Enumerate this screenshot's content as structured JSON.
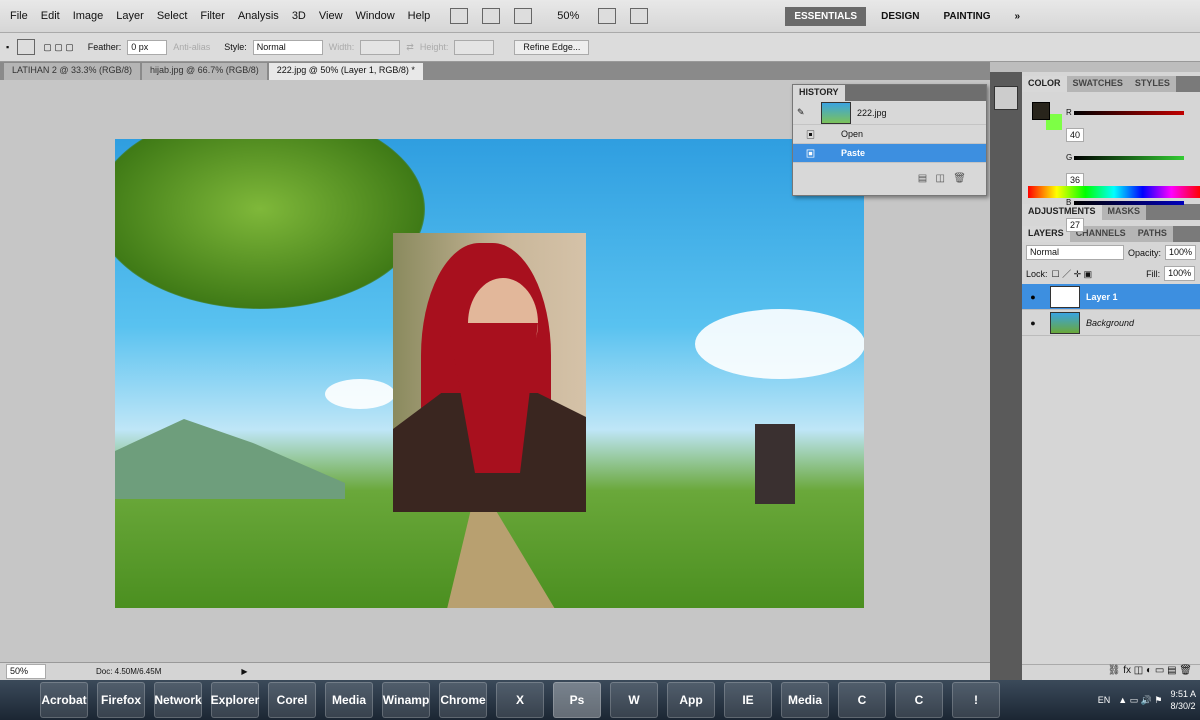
{
  "menu": [
    "File",
    "Edit",
    "Image",
    "Layer",
    "Select",
    "Filter",
    "Analysis",
    "3D",
    "View",
    "Window",
    "Help"
  ],
  "zoom_menu": "50%",
  "workspaces": [
    "ESSENTIALS",
    "DESIGN",
    "PAINTING"
  ],
  "workspace_more": "»",
  "options": {
    "feather_label": "Feather:",
    "feather_value": "0 px",
    "antialias_label": "Anti-alias",
    "style_label": "Style:",
    "style_value": "Normal",
    "width_label": "Width:",
    "height_label": "Height:",
    "refine_edge": "Refine Edge..."
  },
  "tabs": [
    "LATIHAN 2 @ 33.3% (RGB/8)",
    "hijab.jpg @ 66.7% (RGB/8)",
    "222.jpg @ 50% (Layer 1, RGB/8) *"
  ],
  "history": {
    "title": "HISTORY",
    "snapshot": "222.jpg",
    "items": [
      "Open",
      "Paste"
    ],
    "selected": 1
  },
  "color": {
    "tabs": [
      "COLOR",
      "SWATCHES",
      "STYLES"
    ],
    "channels": [
      {
        "label": "R",
        "value": "40",
        "color": "#c00000"
      },
      {
        "label": "G",
        "value": "36",
        "color": "#33cc33"
      },
      {
        "label": "B",
        "value": "27",
        "color": "#0000bb"
      }
    ]
  },
  "adjustments": {
    "tabs": [
      "ADJUSTMENTS",
      "MASKS"
    ]
  },
  "layers": {
    "tabs": [
      "LAYERS",
      "CHANNELS",
      "PATHS"
    ],
    "blend_mode": "Normal",
    "opacity_label": "Opacity:",
    "opacity": "100%",
    "lock_label": "Lock:",
    "fill_label": "Fill:",
    "fill": "100%",
    "items": [
      {
        "name": "Layer 1",
        "selected": true
      },
      {
        "name": "Background",
        "selected": false
      }
    ]
  },
  "status": {
    "zoom": "50%",
    "doc": "Doc: 4.50M/6.45M"
  },
  "taskbar": {
    "apps": [
      "Acrobat",
      "Firefox",
      "Network",
      "Explorer",
      "Corel",
      "Media",
      "Winamp",
      "Chrome",
      "X",
      "Ps",
      "W",
      "App",
      "IE",
      "Media",
      "C",
      "C",
      "!"
    ],
    "lang": "EN",
    "time": "9:51 A",
    "date": "8/30/2"
  }
}
